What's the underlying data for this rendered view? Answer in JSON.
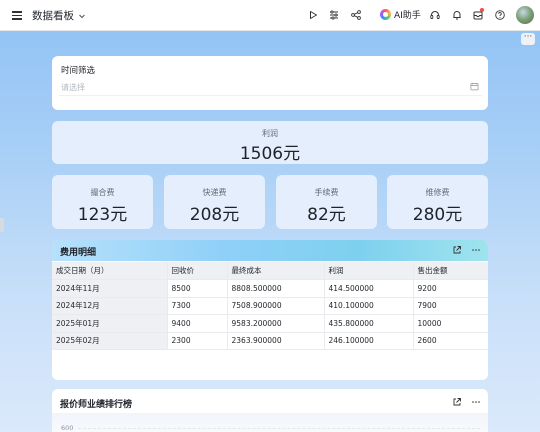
{
  "header": {
    "title": "数据看板",
    "ai_label": "AI助手"
  },
  "filter": {
    "label": "时间筛选",
    "placeholder": "请选择"
  },
  "metrics": {
    "profit": {
      "label": "利润",
      "value": "1506元"
    },
    "cards": [
      {
        "label": "撮合费",
        "value": "123元"
      },
      {
        "label": "快递费",
        "value": "208元"
      },
      {
        "label": "手续费",
        "value": "82元"
      },
      {
        "label": "维修费",
        "value": "280元"
      }
    ]
  },
  "cost_table": {
    "title": "费用明细",
    "columns": [
      "成交日期（月）",
      "回收价",
      "最终成本",
      "利润",
      "售出金额"
    ],
    "rows": [
      [
        "2024年11月",
        "8500",
        "8808.500000",
        "414.500000",
        "9200"
      ],
      [
        "2024年12月",
        "7300",
        "7508.900000",
        "410.100000",
        "7900"
      ],
      [
        "2025年01月",
        "9400",
        "9583.200000",
        "435.800000",
        "10000"
      ],
      [
        "2025年02月",
        "2300",
        "2363.900000",
        "246.100000",
        "2600"
      ]
    ]
  },
  "ranking": {
    "title": "报价师业绩排行榜",
    "y_tick": "600"
  },
  "colors": {
    "accent": "#3370ff",
    "metric_bg": "#e4eefd",
    "table_header_grad": "#8fd0f8"
  },
  "icons": [
    "menu-icon",
    "chevron-down-icon",
    "play-icon",
    "settings-sliders-icon",
    "share-icon",
    "headset-icon",
    "bell-icon",
    "inbox-icon",
    "help-icon",
    "calendar-icon",
    "expand-icon",
    "more-icon"
  ]
}
